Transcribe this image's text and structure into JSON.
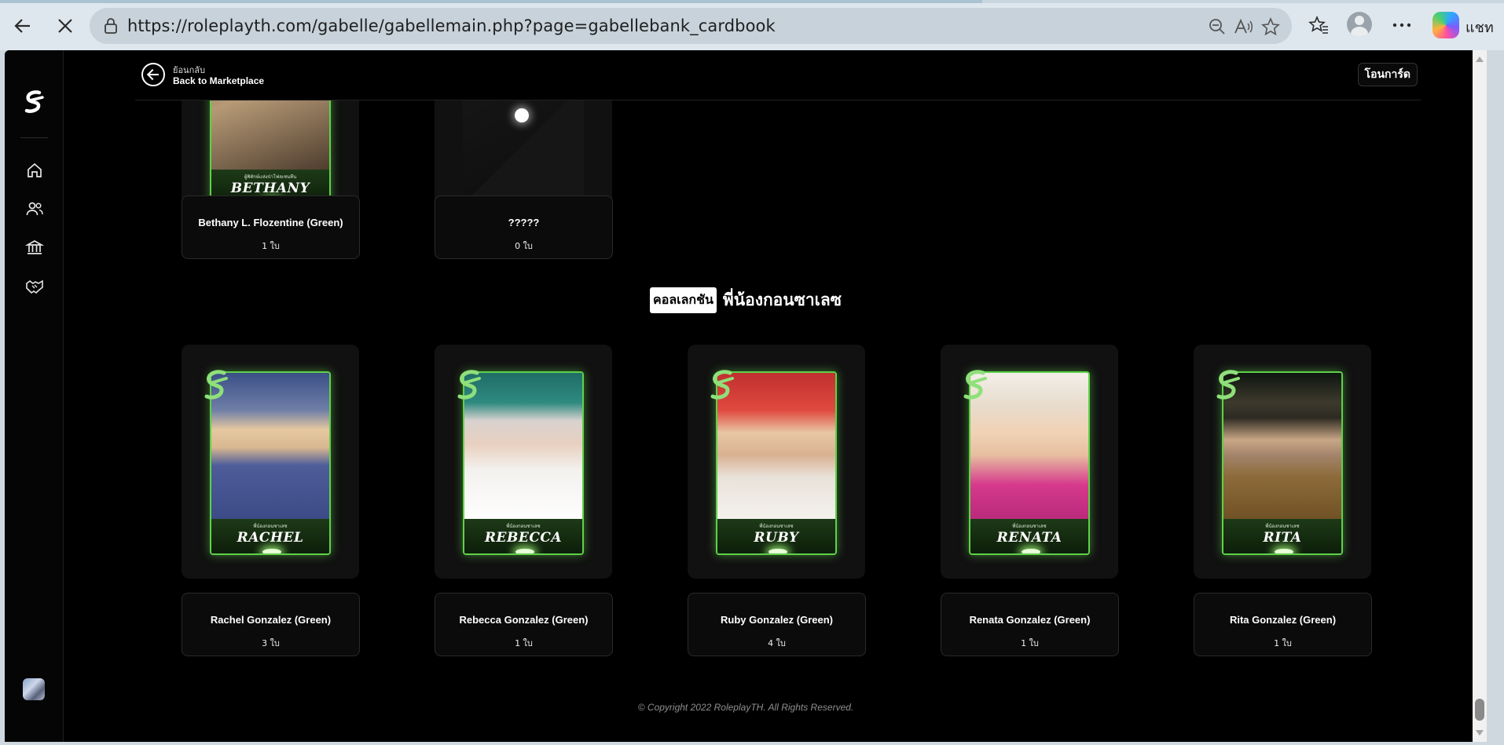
{
  "browser": {
    "url_prefix": "https://",
    "url_host": "roleplayth.com",
    "url_path": "/gabelle/gabellemain.php?page=gabellebank_cardbook",
    "chat_label": "แชท"
  },
  "header": {
    "back_th": "ย้อนกลับ",
    "back_en": "Back to Marketplace",
    "transfer_label": "โอนการ์ด"
  },
  "top_cards": [
    {
      "card_name": "BETHANY",
      "card_subtitle": "ผู้พิทักษ์แห่งป่าโฟลเซนทีน",
      "title": "Bethany L. Flozentine (Green)",
      "count": "1 ใบ"
    },
    {
      "card_name": "",
      "card_subtitle": "",
      "title": "?????",
      "count": "0 ใบ"
    }
  ],
  "collection": {
    "badge": "คอลเลกชัน",
    "name": "พี่น้องกอนซาเลซ"
  },
  "cards": [
    {
      "card_name": "RACHEL",
      "card_subtitle": "พี่น้องกอนซาเลซ",
      "title": "Rachel Gonzalez (Green)",
      "count": "3 ใบ"
    },
    {
      "card_name": "REBECCA",
      "card_subtitle": "พี่น้องกอนซาเลซ",
      "title": "Rebecca Gonzalez (Green)",
      "count": "1 ใบ"
    },
    {
      "card_name": "RUBY",
      "card_subtitle": "พี่น้องกอนซาเลซ",
      "title": "Ruby Gonzalez (Green)",
      "count": "4 ใบ"
    },
    {
      "card_name": "RENATA",
      "card_subtitle": "พี่น้องกอนซาเลซ",
      "title": "Renata Gonzalez (Green)",
      "count": "1 ใบ"
    },
    {
      "card_name": "RITA",
      "card_subtitle": "พี่น้องกอนซาเลซ",
      "title": "Rita Gonzalez (Green)",
      "count": "1 ใบ"
    }
  ],
  "footer": {
    "copyright": "© Copyright 2022 RoleplayTH. All Rights Reserved."
  },
  "colors": {
    "card_border": "#5fd14a",
    "page_bg": "#000000"
  }
}
